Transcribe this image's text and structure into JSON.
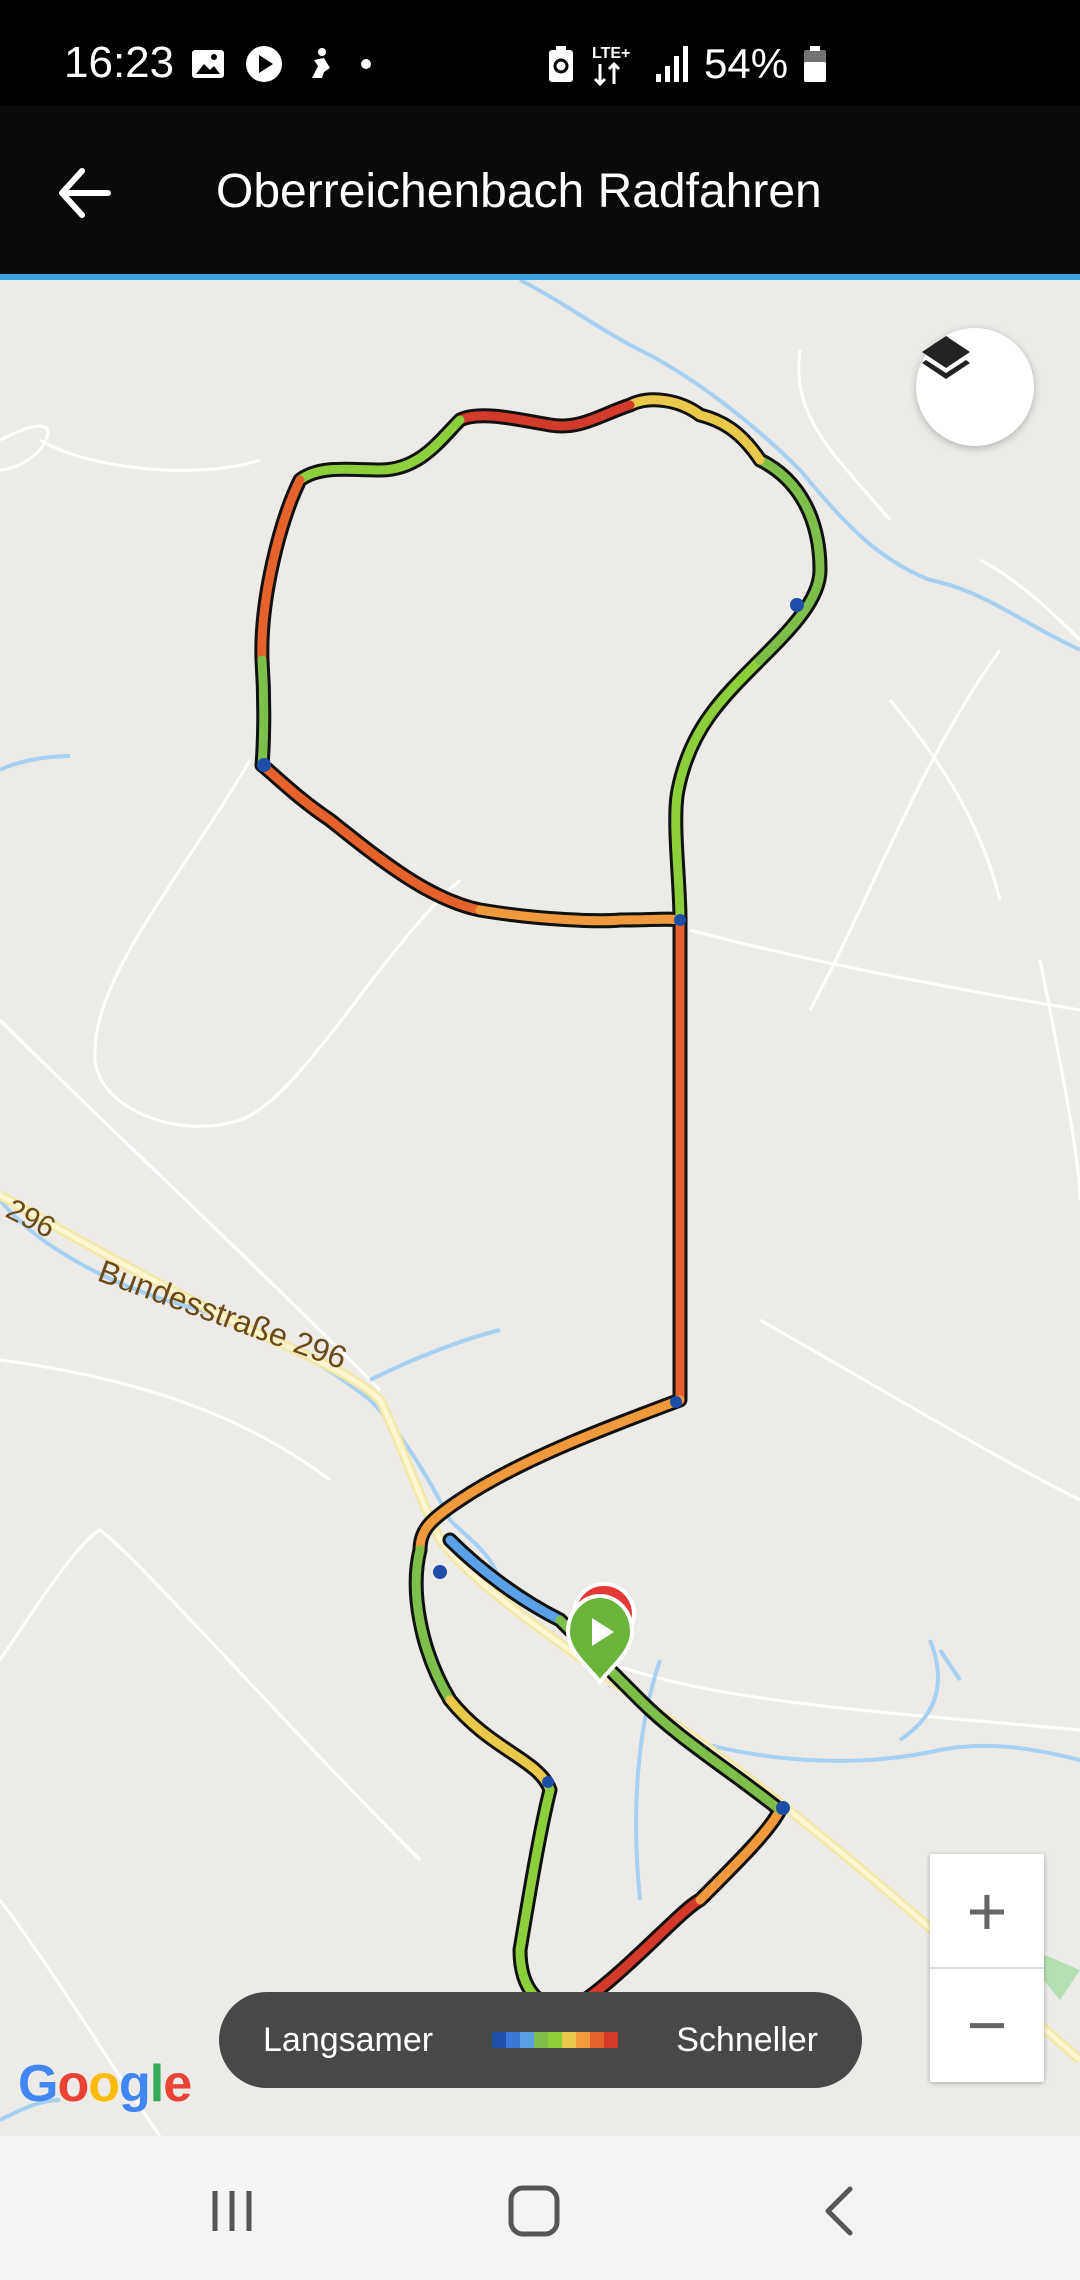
{
  "status_bar": {
    "time": "16:23",
    "left_icons": [
      "image-icon",
      "play-icon",
      "fitness-icon",
      "dot-icon"
    ],
    "right_icons": [
      "battery-saver-icon",
      "lte-icon",
      "signal-icon",
      "battery-icon"
    ],
    "network_label": "LTE+",
    "battery": "54%"
  },
  "app_bar": {
    "back_icon": "arrow-left-icon",
    "title": "Oberreichenbach Radfahren",
    "accent_color": "#3aa0e0"
  },
  "map": {
    "road_shield_label": "296",
    "road_label": "Bundesstraße 296",
    "layers_icon": "layers-icon",
    "start_marker_icon": "play-icon",
    "start_marker_color": "#6ab43c",
    "end_marker_color": "#e53935",
    "zoom_in_label": "+",
    "zoom_out_label": "−",
    "attribution": "Google"
  },
  "legend": {
    "slow_label": "Langsamer",
    "fast_label": "Schneller",
    "scale_colors": [
      "#1e4fa8",
      "#3b78d8",
      "#5aa0e6",
      "#7dbf4a",
      "#8ccf3a",
      "#e9c84a",
      "#ef9a3c",
      "#e5622c",
      "#d43a2a"
    ]
  },
  "nav_bar": {
    "recent_icon": "recent-apps-icon",
    "home_icon": "home-icon",
    "back_icon": "back-chevron-icon"
  }
}
